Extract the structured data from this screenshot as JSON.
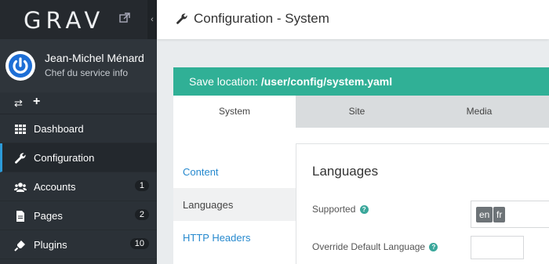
{
  "sidebar": {
    "logo": "GRAV",
    "user": {
      "name": "Jean-Michel Ménard",
      "role": "Chef du service info"
    },
    "nav": [
      {
        "label": "Dashboard",
        "icon": "grid-icon",
        "badge": ""
      },
      {
        "label": "Configuration",
        "icon": "wrench-icon",
        "badge": ""
      },
      {
        "label": "Accounts",
        "icon": "users-icon",
        "badge": "1"
      },
      {
        "label": "Pages",
        "icon": "file-icon",
        "badge": "2"
      },
      {
        "label": "Plugins",
        "icon": "plug-icon",
        "badge": "10"
      }
    ]
  },
  "header": {
    "title": "Configuration - System"
  },
  "save": {
    "prefix": "Save location:",
    "path": "/user/config/system.yaml"
  },
  "tabs": [
    "System",
    "Site",
    "Media"
  ],
  "sections": [
    "Content",
    "Languages",
    "HTTP Headers"
  ],
  "form": {
    "heading": "Languages",
    "supported_label": "Supported",
    "supported_values": [
      "en",
      "fr"
    ],
    "override_label": "Override Default Language",
    "help_glyph": "?"
  },
  "colors": {
    "accent": "#30b096",
    "link": "#2689ce",
    "sidebar": "#2b3137"
  }
}
